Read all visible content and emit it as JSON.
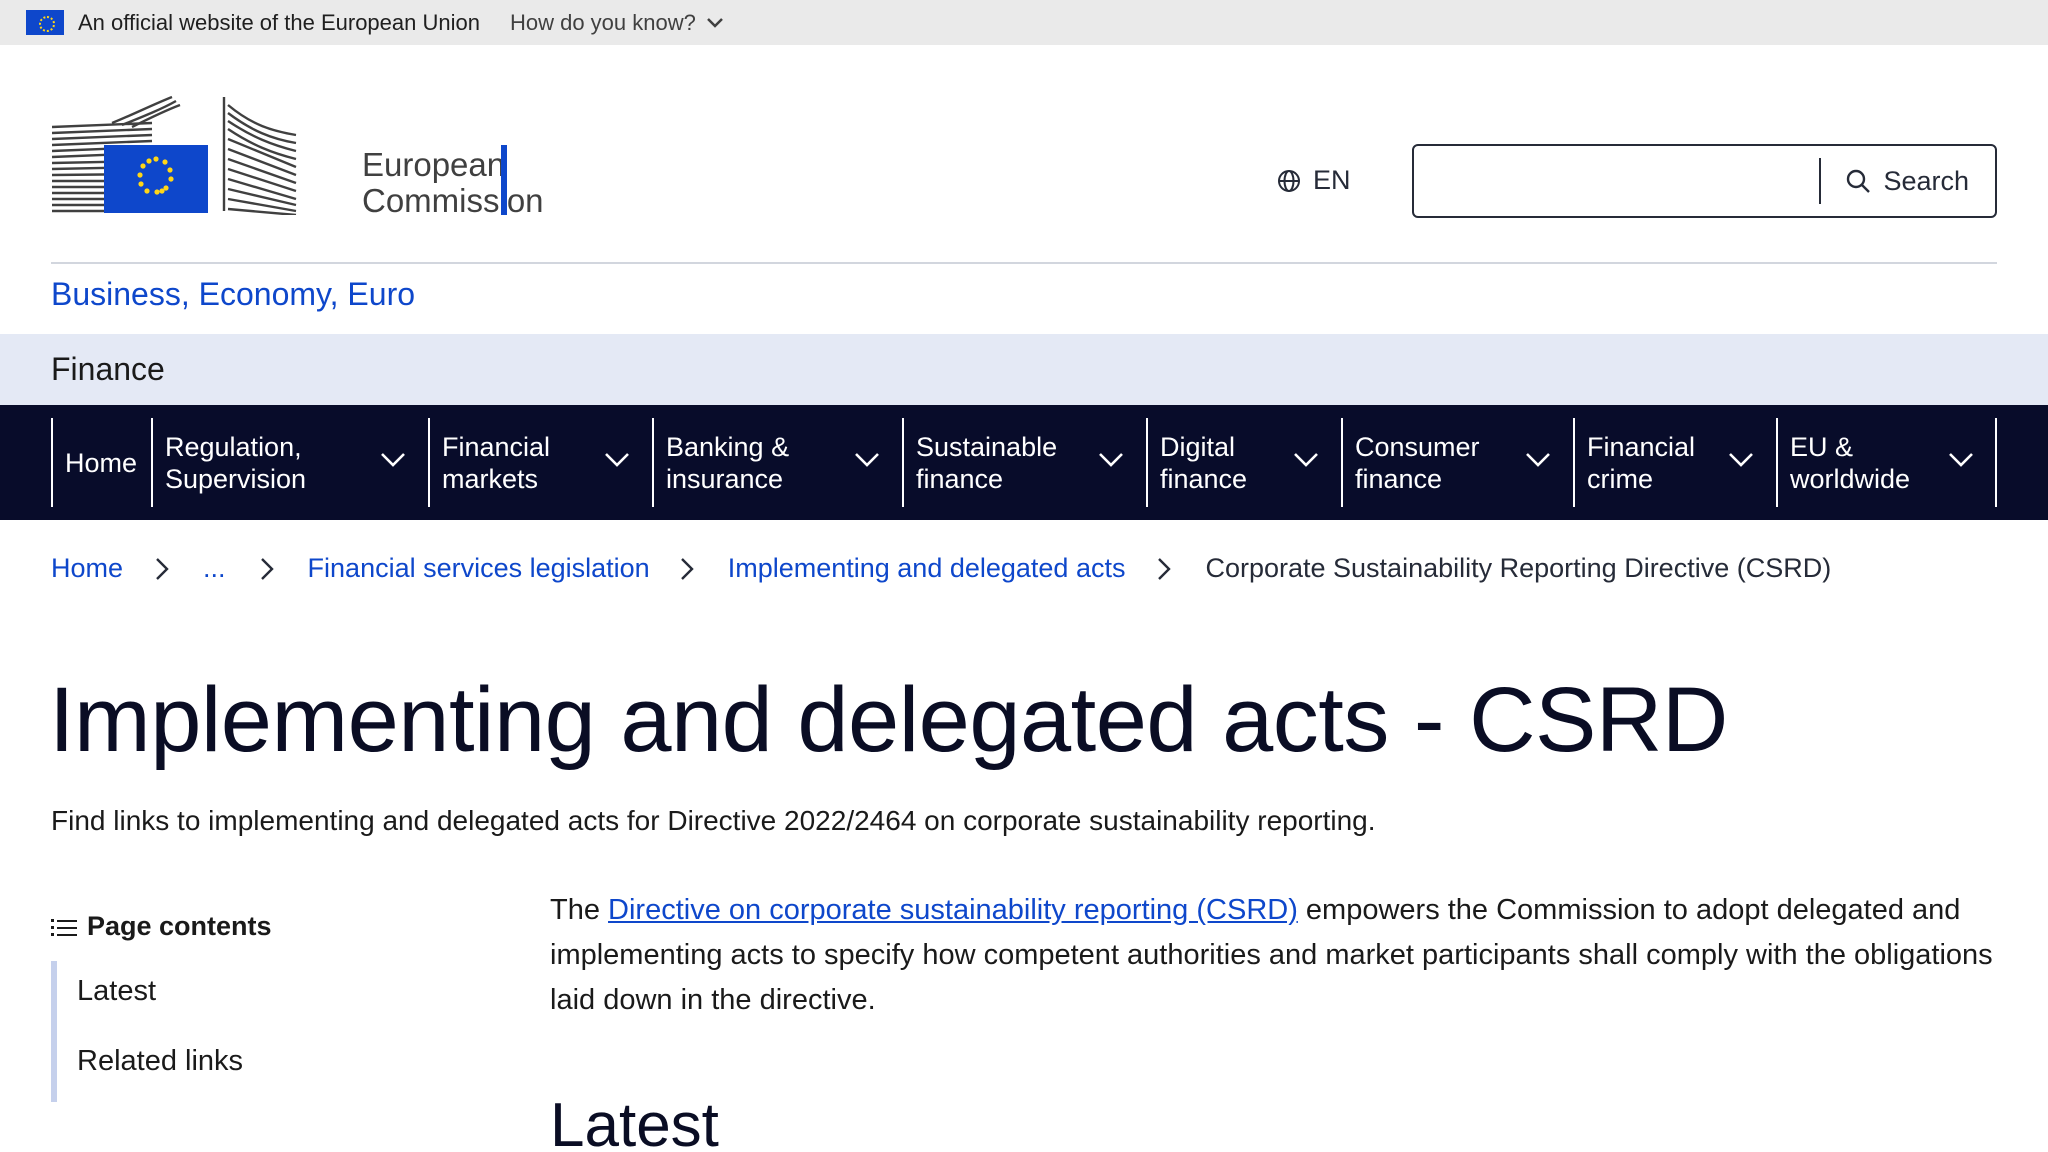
{
  "eu_bar": {
    "official_text": "An official website of the European Union",
    "how_know": "How do you know?"
  },
  "header": {
    "logo_line1": "European",
    "logo_line2": "Commission",
    "language": "EN",
    "search_placeholder": "",
    "search_label": "Search"
  },
  "site": {
    "name": "Business, Economy, Euro",
    "section": "Finance"
  },
  "nav": {
    "items": [
      {
        "line1": "Home",
        "line2": ""
      },
      {
        "line1": "Regulation,",
        "line2": "Supervision"
      },
      {
        "line1": "Financial",
        "line2": "markets"
      },
      {
        "line1": "Banking &",
        "line2": "insurance"
      },
      {
        "line1": "Sustainable",
        "line2": "finance"
      },
      {
        "line1": "Digital",
        "line2": "finance"
      },
      {
        "line1": "Consumer",
        "line2": "finance"
      },
      {
        "line1": "Financial",
        "line2": "crime"
      },
      {
        "line1": "EU &",
        "line2": "worldwide"
      }
    ]
  },
  "breadcrumb": {
    "home": "Home",
    "ellipsis": "...",
    "level1": "Financial services legislation",
    "level2": "Implementing and delegated acts",
    "current": "Corporate Sustainability Reporting Directive (CSRD)"
  },
  "page": {
    "title": "Implementing and delegated acts - CSRD",
    "description": "Find links to implementing and delegated acts for Directive 2022/2464 on corporate sustainability reporting."
  },
  "toc": {
    "heading": "Page contents",
    "items": [
      "Latest",
      "Related links"
    ]
  },
  "intro": {
    "prefix": "The ",
    "link": "Directive on corporate sustainability reporting (CSRD)",
    "suffix": " empowers the Commission to adopt delegated and implementing acts to specify how competent authorities and market participants shall comply with the obligations laid down in the directive."
  },
  "latest_heading": "Latest",
  "colors": {
    "eu_blue": "#0e47cb",
    "nav_bg": "#080c2a",
    "band_bg": "#e4e9f5",
    "toc_accent": "#c5d0ec"
  }
}
